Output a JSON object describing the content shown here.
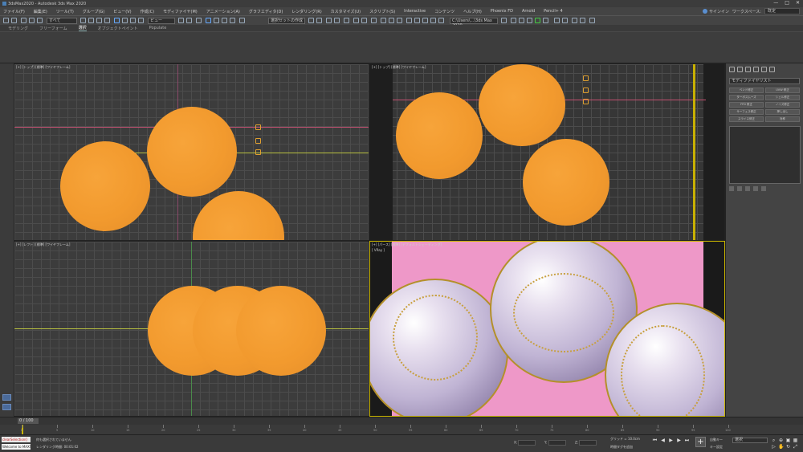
{
  "window": {
    "title": "3dsMax2020 - Autodesk 3ds Max 2020",
    "controls": [
      "—",
      "□",
      "✕"
    ]
  },
  "menubar": {
    "items": [
      "ファイル(F)",
      "編集(E)",
      "ツール(T)",
      "グループ(G)",
      "ビュー(V)",
      "作成(C)",
      "モディファイヤ(M)",
      "アニメーション(A)",
      "グラフエディタ(D)",
      "レンダリング(R)",
      "カスタマイズ(U)",
      "スクリプト(S)",
      "Interactive",
      "コンテンツ",
      "ヘルプ(H)",
      "Phoenix FD",
      "Arnold",
      "Pencil+ 4"
    ],
    "signin": "サインイン",
    "workspace_label": "ワークスペース:",
    "workspace_value": "既定"
  },
  "toolbar": {
    "filter_select": "すべて",
    "view_select": "ビュー",
    "selection_set": "選択セットの作成",
    "path_field": "C:\\Users\\...\\3ds Max 2020"
  },
  "ribbon": {
    "tabs": [
      "モデリング",
      "フリーフォーム",
      "選択",
      "オブジェクトペイント",
      "Populate"
    ],
    "active_tab": "選択"
  },
  "viewports": {
    "top_left": "[+] [トップ] [標準] [ワイヤフレーム]",
    "top_right": "[+] [トップ] [標準] [ワイヤフレーム]",
    "bottom_left": "[+] [レフト] [標準] [ワイヤフレーム]",
    "bottom_right": "[+] [パース] [標準] [デフォルトシェーディング]",
    "bottom_right_sub": "[ VRay ]"
  },
  "command_panel": {
    "dropdown": "モディファイヤリスト",
    "buttons": [
      "ベンド修正",
      "UVW 修正",
      "ターボスムーズ",
      "シェル修正",
      "FFD 修正",
      "ノイズ修正",
      "サーフェス修正",
      "押し出し",
      "スライス修正",
      "対称"
    ]
  },
  "timeline": {
    "frame": "0 / 100",
    "ticks": [
      "0",
      "5",
      "10",
      "15",
      "20",
      "25",
      "30",
      "35",
      "40",
      "45",
      "50",
      "55",
      "60",
      "65",
      "70",
      "75",
      "80",
      "85",
      "90",
      "95",
      "100"
    ]
  },
  "statusbar": {
    "maxscript_line1": "clearSelection()",
    "maxscript_line2": "Welcome to MAXScript.",
    "status1": "何も選択されていません",
    "status2": "レンダリング時間: 00:01:02",
    "grid_label": "グリッド = 10.0cm",
    "time_tag": "時間タグを追加",
    "auto_key": "自動キー",
    "set_key": "キー設定",
    "selection_drop": "選択"
  },
  "colors": {
    "sphere_orange": "#f29a2e",
    "persp_background": "#ee98c8",
    "active_border": "#c8b400"
  }
}
